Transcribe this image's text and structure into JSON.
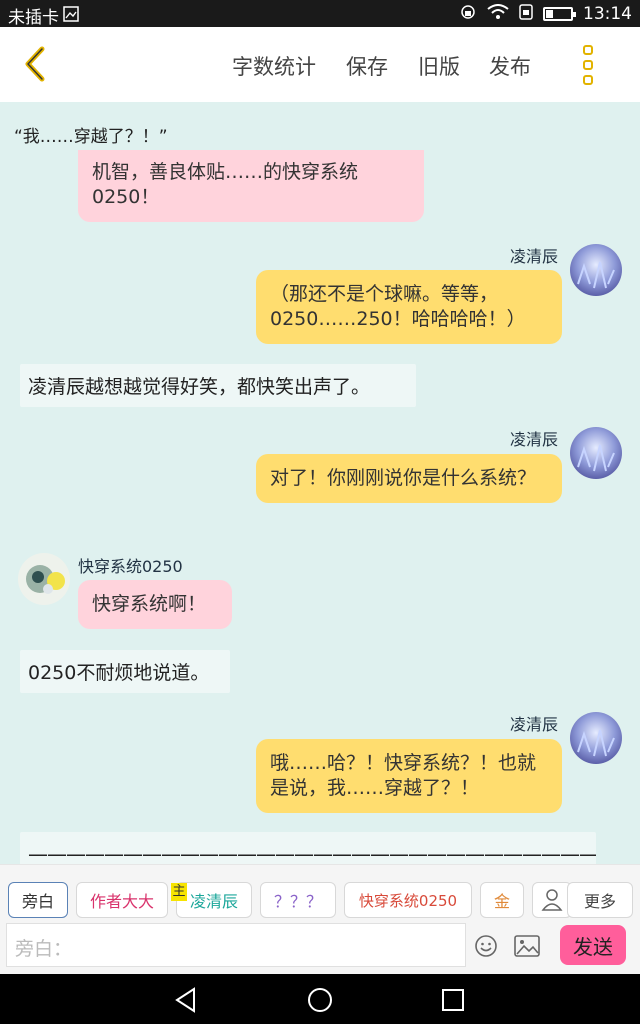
{
  "status_bar": {
    "carrier": "未插卡",
    "time": "13:14"
  },
  "toolbar": {
    "word_count": "字数统计",
    "save": "保存",
    "old_version": "旧版",
    "publish": "发布"
  },
  "chat": {
    "top_narration": "“我……穿越了？！”",
    "msg1": {
      "text": "机智，善良体贴……的快穿系统0250！"
    },
    "msg2": {
      "speaker": "凌清辰",
      "text": "（那还不是个球嘛。等等，0250……250！哈哈哈哈！）"
    },
    "narr1": "凌清辰越想越觉得好笑，都快笑出声了。",
    "msg3": {
      "speaker": "凌清辰",
      "text": "对了！你刚刚说你是什么系统？"
    },
    "msg4": {
      "speaker": "快穿系统0250",
      "text": "快穿系统啊！"
    },
    "narr2": "0250不耐烦地说道。",
    "msg5": {
      "speaker": "凌清辰",
      "text": "哦……哈？！快穿系统？！也就是说，我……穿越了？！"
    },
    "divider": "———————————————————————————————————"
  },
  "roles": {
    "narrator": "旁白",
    "author": "作者大大",
    "main_badge": "主",
    "lingqingchen": "凌清辰",
    "unknown": "？？？",
    "system": "快穿系统0250",
    "jin": "金",
    "more": "更多"
  },
  "input": {
    "placeholder": "旁白：",
    "send": "发送"
  },
  "colors": {
    "accent": "#e2b300",
    "pink_bubble": "#ffd3dc",
    "yellow_bubble": "#ffdd6f",
    "send": "#ff5e9b"
  }
}
